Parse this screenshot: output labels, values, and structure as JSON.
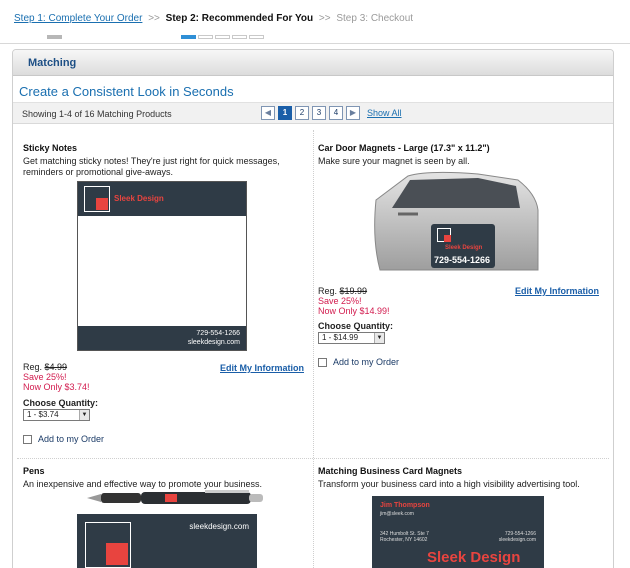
{
  "steps": {
    "step1": "Step 1: Complete Your Order",
    "step2": "Step 2: Recommended For You",
    "step3": "Step 3: Checkout",
    "separator": ">>"
  },
  "panel": {
    "title": "Matching",
    "subtitle": "Create a Consistent Look in Seconds",
    "showing": "Showing 1-4 of 16 Matching Products",
    "pages": [
      "1",
      "2",
      "3",
      "4"
    ],
    "show_all": "Show All"
  },
  "products": [
    {
      "title": "Sticky Notes",
      "desc": "Get matching sticky notes! They're just right for quick messages, reminders or promotional give-aways.",
      "reg_label": "Reg.",
      "reg_price": "$4.99",
      "save": "Save 25%!",
      "now": "Now Only $3.74!",
      "edit": "Edit My Information",
      "qty_label": "Choose Quantity:",
      "qty_value": "1 - $3.74",
      "add": "Add to my Order",
      "brand": "Sleek Design",
      "phone": "729-554-1266",
      "site": "sleekdesign.com"
    },
    {
      "title": "Car Door Magnets - Large (17.3\" x 11.2\")",
      "desc": "Make sure your magnet is seen by all.",
      "reg_label": "Reg.",
      "reg_price": "$19.99",
      "save": "Save 25%!",
      "now": "Now Only $14.99!",
      "edit": "Edit My Information",
      "qty_label": "Choose Quantity:",
      "qty_value": "1 - $14.99",
      "add": "Add to my Order",
      "brand": "Sleek Design",
      "phone": "729-554-1266"
    },
    {
      "title": "Pens",
      "desc": "An inexpensive and effective way to promote your business.",
      "site": "sleekdesign.com"
    },
    {
      "title": "Matching Business Card Magnets",
      "desc": "Transform your business card into a high visibility advertising tool.",
      "name": "Jim Thompson",
      "email": "jim@sleek.com",
      "addr1": "342 Humbolt St. Ste 7",
      "addr2": "Rochester, NY 14602",
      "phone": "729-554-1266",
      "site": "sleekdesign.com",
      "brand": "Sleek Design"
    }
  ],
  "colors": {
    "accent": "#1a6fb0",
    "promo": "#d21b4e",
    "dark": "#2f3b46",
    "brand_red": "#e8443f"
  }
}
